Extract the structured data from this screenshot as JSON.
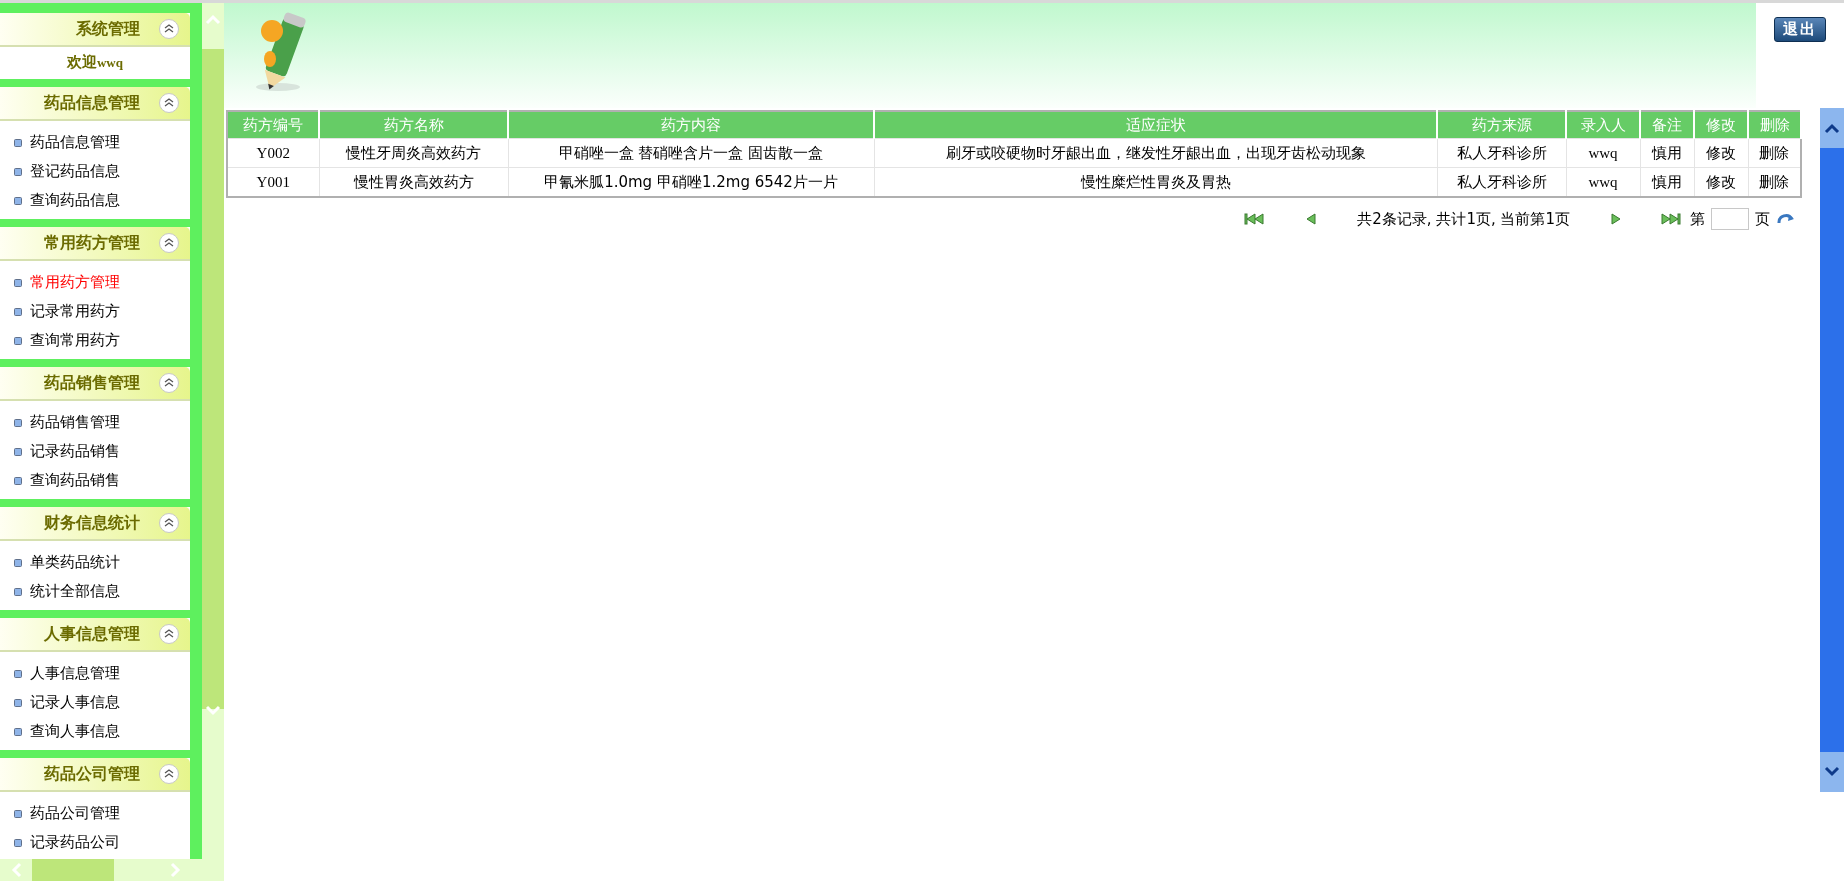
{
  "sidebar": {
    "sections": [
      {
        "kind": "welcome",
        "title": "系统管理",
        "welcome": "欢迎",
        "user": "wwq"
      },
      {
        "kind": "menu",
        "title": "药品信息管理",
        "items": [
          {
            "label": "药品信息管理",
            "selected": false
          },
          {
            "label": "登记药品信息",
            "selected": false
          },
          {
            "label": "查询药品信息",
            "selected": false
          }
        ]
      },
      {
        "kind": "menu",
        "title": "常用药方管理",
        "items": [
          {
            "label": "常用药方管理",
            "selected": true
          },
          {
            "label": "记录常用药方",
            "selected": false
          },
          {
            "label": "查询常用药方",
            "selected": false
          }
        ]
      },
      {
        "kind": "menu",
        "title": "药品销售管理",
        "items": [
          {
            "label": "药品销售管理",
            "selected": false
          },
          {
            "label": "记录药品销售",
            "selected": false
          },
          {
            "label": "查询药品销售",
            "selected": false
          }
        ]
      },
      {
        "kind": "menu",
        "title": "财务信息统计",
        "items": [
          {
            "label": "单类药品统计",
            "selected": false
          },
          {
            "label": "统计全部信息",
            "selected": false
          }
        ]
      },
      {
        "kind": "menu",
        "title": "人事信息管理",
        "items": [
          {
            "label": "人事信息管理",
            "selected": false
          },
          {
            "label": "记录人事信息",
            "selected": false
          },
          {
            "label": "查询人事信息",
            "selected": false
          }
        ]
      },
      {
        "kind": "menu",
        "title": "药品公司管理",
        "items": [
          {
            "label": "药品公司管理",
            "selected": false
          },
          {
            "label": "记录药品公司",
            "selected": false
          }
        ]
      }
    ]
  },
  "logout_button": "退出",
  "table": {
    "columns": [
      "药方编号",
      "药方名称",
      "药方内容",
      "适应症状",
      "药方来源",
      "录入人",
      "备注",
      "修改",
      "删除"
    ],
    "rows": [
      [
        "Y002",
        "慢性牙周炎高效药方",
        "甲硝唑一盒 替硝唑含片一盒 固齿散一盒",
        "刷牙或咬硬物时牙龈出血，继发性牙龈出血，出现牙齿松动现象",
        "私人牙科诊所",
        "wwq",
        "慎用",
        "修改",
        "删除"
      ],
      [
        "Y001",
        "慢性胃炎高效药方",
        "甲氰米胍1.0mg 甲硝唑1.2mg 6542片一片",
        "慢性糜烂性胃炎及胃热",
        "私人牙科诊所",
        "wwq",
        "慎用",
        "修改",
        "删除"
      ]
    ]
  },
  "pagination": {
    "summary": "共2条记录, 共计1页, 当前第1页",
    "page_prefix": "第",
    "page_suffix": "页"
  }
}
